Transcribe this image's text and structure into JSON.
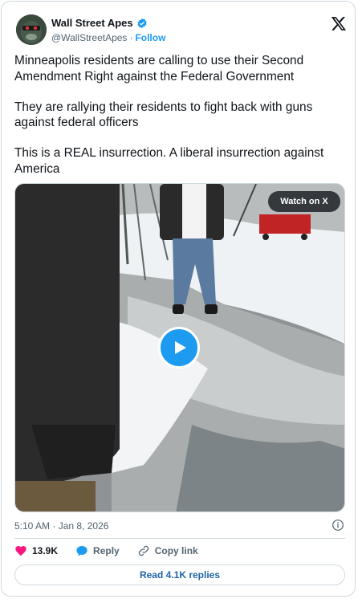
{
  "author": {
    "name": "Wall Street Apes",
    "handle": "@WallStreetApes",
    "separator": "·",
    "follow_label": "Follow"
  },
  "tweet": {
    "paragraphs": [
      "Minneapolis residents are calling to use their Second Amendment Right against the Federal Government",
      "They are rallying their residents to fight back with guns against federal officers",
      "This is a REAL insurrection. A liberal insurrection against America"
    ]
  },
  "media": {
    "watch_label": "Watch on X"
  },
  "meta": {
    "timestamp": "5:10 AM · Jan 8, 2026"
  },
  "actions": {
    "likes": "13.9K",
    "reply_label": "Reply",
    "copy_label": "Copy link",
    "read_replies": "Read 4.1K replies"
  },
  "colors": {
    "accent": "#1d9bf0",
    "like": "#f91880",
    "border": "#cfd9de",
    "muted": "#536471"
  },
  "icons": [
    "x-logo-icon",
    "verified-badge-icon",
    "play-icon",
    "info-icon",
    "heart-icon",
    "reply-bubble-icon",
    "link-icon"
  ]
}
